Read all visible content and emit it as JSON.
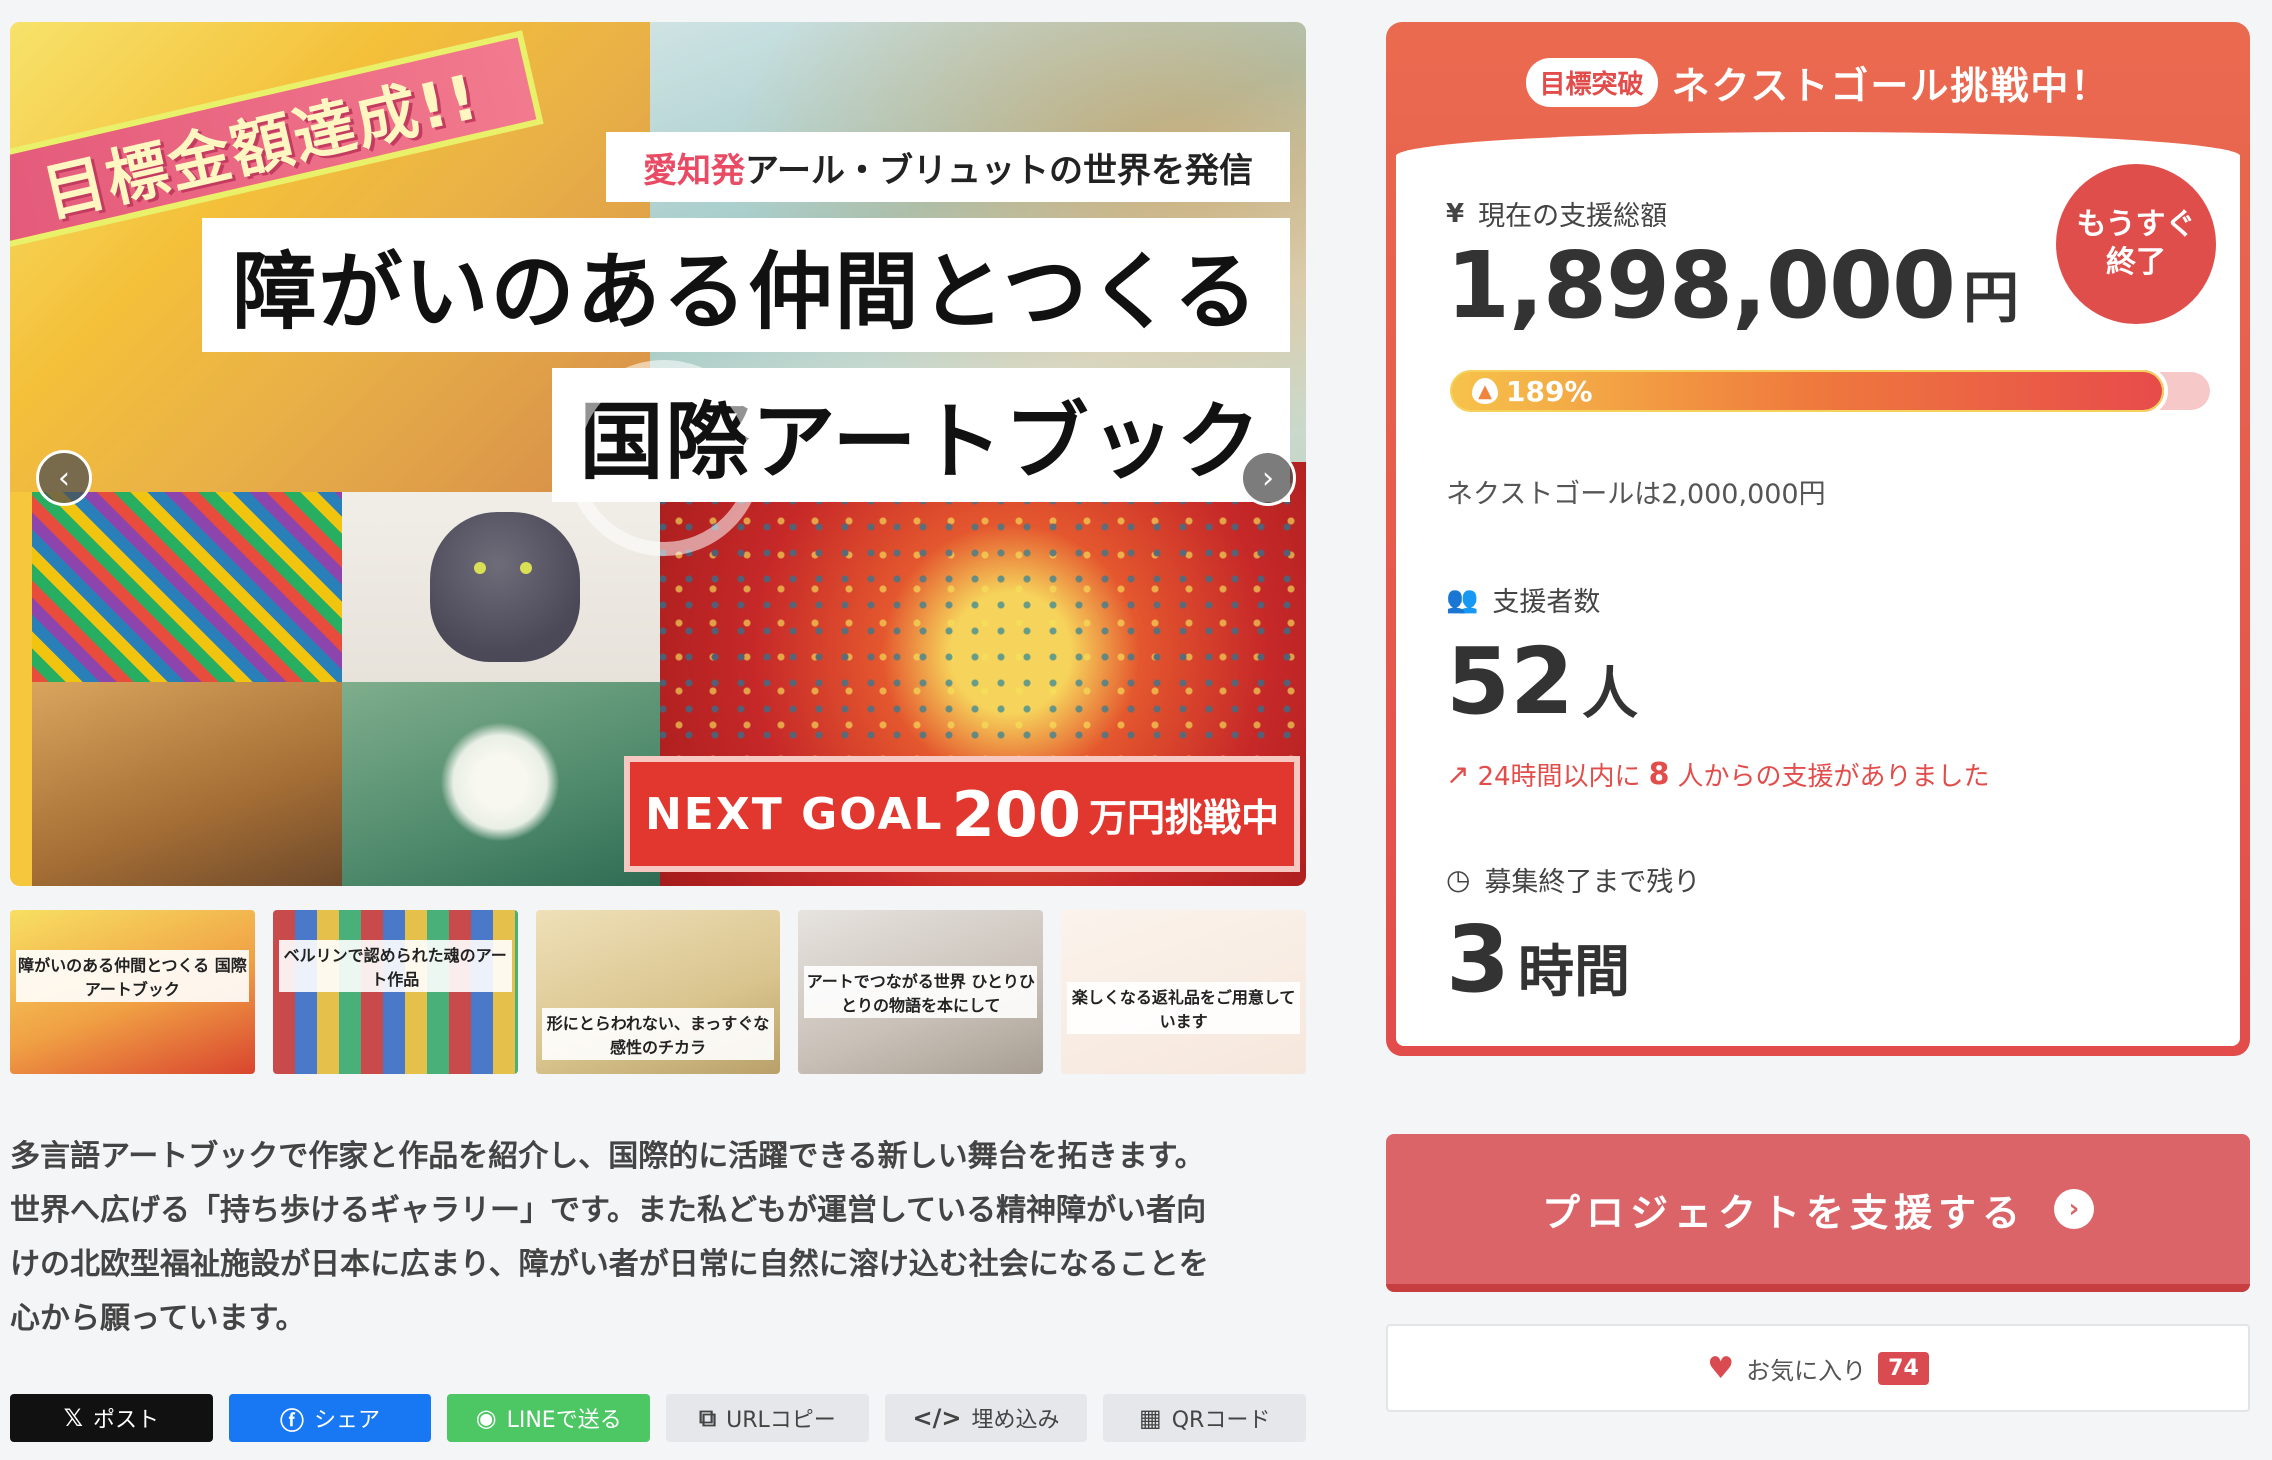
{
  "hero": {
    "ribbon": "目標金額達成!!",
    "subtitle_accent": "愛知発",
    "subtitle_rest": "アール・ブリュットの世界を発信",
    "title_line1": "障がいのある仲間とつくる",
    "title_line2": "国際アートブック",
    "nextgoal_a": "NEXT GOAL",
    "nextgoal_b": "200",
    "nextgoal_c": "万円挑戦中",
    "prev_icon": "chevron-left-icon",
    "next_icon": "chevron-right-icon"
  },
  "thumbnails": [
    {
      "caption": "障がいのある仲間とつくる 国際アートブック"
    },
    {
      "caption": "ベルリンで認められた魂のアート作品"
    },
    {
      "caption": "形にとらわれない、まっすぐな感性のチカラ"
    },
    {
      "caption": "アートでつながる世界 ひとりひとりの物語を本にして"
    },
    {
      "caption": "楽しくなる返礼品をご用意しています"
    }
  ],
  "description": [
    "多言語アートブックで作家と作品を紹介し、国際的に活躍できる新しい舞台を拓きます。",
    "世界へ広げる「持ち歩けるギャラリー」です。また私どもが運営している精神障がい者向",
    "けの北欧型福祉施設が日本に広まり、障がい者が日常に自然に溶け込む社会になることを",
    "心から願っています。"
  ],
  "share": {
    "x": "ポスト",
    "facebook": "シェア",
    "line": "LINEで送る",
    "url": "URLコピー",
    "embed": "埋め込み",
    "qr": "QRコード"
  },
  "card": {
    "badge": "目標突破",
    "header": "ネクストゴール挑戦中！",
    "amount_label": "現在の支援総額",
    "amount": "1,898,000",
    "amount_unit": "円",
    "soon_line1": "もうすぐ",
    "soon_line2": "終了",
    "progress_text": "189%",
    "progress_percent": 189,
    "next_goal": "ネクストゴールは2,000,000円",
    "supporters_label": "支援者数",
    "supporters": "52",
    "supporters_unit": "人",
    "recent_pre": "24時間以内に",
    "recent_n": "8",
    "recent_post": "人からの支援がありました",
    "time_label": "募集終了まで残り",
    "time": "3",
    "time_unit": "時間"
  },
  "support_button": "プロジェクトを支援する",
  "favorite": {
    "label": "お気に入り",
    "count": "74"
  },
  "colors": {
    "accent": "#e24d4b",
    "support_button": "#db6468",
    "facebook": "#1877f2",
    "line": "#4cc764"
  }
}
